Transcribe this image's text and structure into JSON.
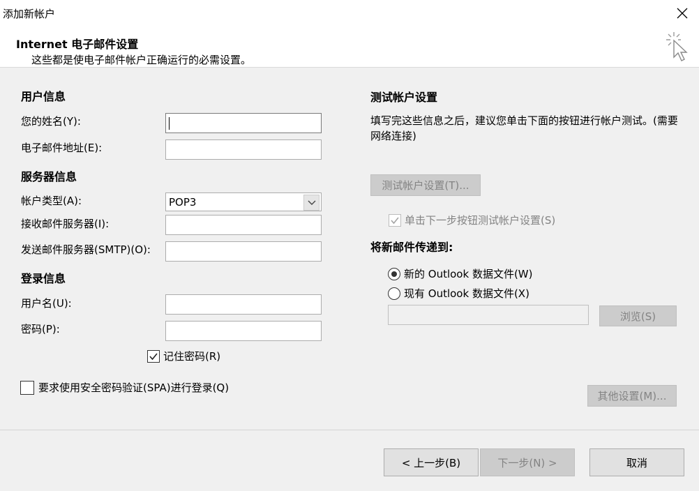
{
  "window": {
    "title": "添加新帐户"
  },
  "header": {
    "title": "Internet 电子邮件设置",
    "subtitle": "这些都是使电子邮件帐户正确运行的必需设置。"
  },
  "user_info": {
    "section": "用户信息",
    "name_label": "您的姓名(Y):",
    "name_value": "",
    "email_label": "电子邮件地址(E):",
    "email_value": ""
  },
  "server_info": {
    "section": "服务器信息",
    "account_type_label": "帐户类型(A):",
    "account_type_value": "POP3",
    "incoming_label": "接收邮件服务器(I):",
    "incoming_value": "",
    "outgoing_label": "发送邮件服务器(SMTP)(O):",
    "outgoing_value": ""
  },
  "login_info": {
    "section": "登录信息",
    "username_label": "用户名(U):",
    "username_value": "",
    "password_label": "密码(P):",
    "password_value": "",
    "remember_label": "记住密码(R)",
    "remember_checked": true,
    "spa_label": "要求使用安全密码验证(SPA)进行登录(Q)",
    "spa_checked": false
  },
  "test_settings": {
    "section": "测试帐户设置",
    "description": "填写完这些信息之后，建议您单击下面的按钮进行帐户测试。(需要网络连接)",
    "test_button": "测试帐户设置(T)...",
    "auto_test_label": "单击下一步按钮测试帐户设置(S)",
    "auto_test_checked": true
  },
  "deliver": {
    "section": "将新邮件传递到:",
    "new_file_label": "新的 Outlook 数据文件(W)",
    "existing_file_label": "现有 Outlook 数据文件(X)",
    "selected": "new",
    "path_value": "",
    "browse_button": "浏览(S)"
  },
  "more_settings_button": "其他设置(M)...",
  "footer": {
    "back_button": "< 上一步(B)",
    "next_button": "下一步(N) >",
    "cancel_button": "取消"
  },
  "colors": {
    "disabled_text": "#838383",
    "button_bg": "#e1e1e1",
    "window_bg": "#f0f0f0"
  },
  "icons": {
    "close": "close-icon",
    "cursor": "click-cursor-icon",
    "check": "check-icon",
    "dropdown": "chevron-down-icon"
  }
}
